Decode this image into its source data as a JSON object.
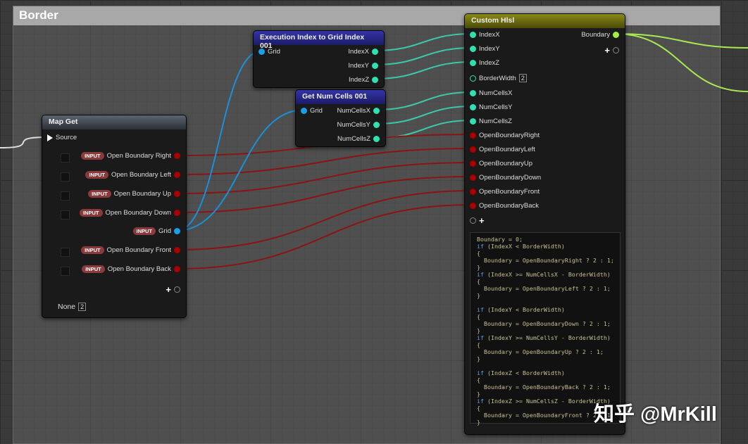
{
  "comment": {
    "title": "Border"
  },
  "exec_node": {
    "title": "Execution Index to Grid Index 001",
    "input": "Grid",
    "outputs": [
      "IndexX",
      "IndexY",
      "IndexZ"
    ]
  },
  "numcells_node": {
    "title": "Get Num Cells 001",
    "input": "Grid",
    "outputs": [
      "NumCellsX",
      "NumCellsY",
      "NumCellsZ"
    ]
  },
  "mapget_node": {
    "title": "Map Get",
    "source": "Source",
    "badge": "INPUT",
    "pins": [
      "Open Boundary Right",
      "Open Boundary  Left",
      "Open Boundary Up",
      "Open Boundary Down",
      "Grid",
      "Open Boundary Front",
      "Open Boundary Back"
    ],
    "none_label": "None",
    "none_value": "2"
  },
  "hlsl_node": {
    "title": "Custom Hlsl",
    "output": "Boundary",
    "inputs": [
      "IndexX",
      "IndexY",
      "IndexZ",
      "BorderWidth",
      "NumCellsX",
      "NumCellsY",
      "NumCellsZ",
      "OpenBoundaryRight",
      "OpenBoundaryLeft",
      "OpenBoundaryUp",
      "OpenBoundaryDown",
      "OpenBoundaryFront",
      "OpenBoundaryBack"
    ],
    "border_width_value": "2",
    "code": [
      {
        "kw": "",
        "t": "Boundary = 0;"
      },
      {
        "kw": "if",
        "t": " (IndexX < BorderWidth)"
      },
      {
        "kw": "",
        "t": "{"
      },
      {
        "kw": "",
        "t": "  Boundary = OpenBoundaryRight ? 2 : 1;"
      },
      {
        "kw": "",
        "t": "}"
      },
      {
        "kw": "if",
        "t": " (IndexX >= NumCellsX - BorderWidth)"
      },
      {
        "kw": "",
        "t": "{"
      },
      {
        "kw": "",
        "t": "  Boundary = OpenBoundaryLeft ? 2 : 1;"
      },
      {
        "kw": "",
        "t": "}"
      },
      {
        "kw": "",
        "t": ""
      },
      {
        "kw": "if",
        "t": " (IndexY < BorderWidth)"
      },
      {
        "kw": "",
        "t": "{"
      },
      {
        "kw": "",
        "t": "  Boundary = OpenBoundaryDown ? 2 : 1;"
      },
      {
        "kw": "",
        "t": "}"
      },
      {
        "kw": "if",
        "t": " (IndexY >= NumCellsY - BorderWidth)"
      },
      {
        "kw": "",
        "t": "{"
      },
      {
        "kw": "",
        "t": "  Boundary = OpenBoundaryUp ? 2 : 1;"
      },
      {
        "kw": "",
        "t": "}"
      },
      {
        "kw": "",
        "t": ""
      },
      {
        "kw": "if",
        "t": " (IndexZ < BorderWidth)"
      },
      {
        "kw": "",
        "t": "{"
      },
      {
        "kw": "",
        "t": "  Boundary = OpenBoundaryBack ? 2 : 1;"
      },
      {
        "kw": "",
        "t": "}"
      },
      {
        "kw": "if",
        "t": " (IndexZ >= NumCellsZ - BorderWidth)"
      },
      {
        "kw": "",
        "t": "{"
      },
      {
        "kw": "",
        "t": "  Boundary = OpenBoundaryFront ? 2 : 1;"
      },
      {
        "kw": "",
        "t": "}"
      }
    ]
  },
  "watermark": "知乎 @MrKill"
}
